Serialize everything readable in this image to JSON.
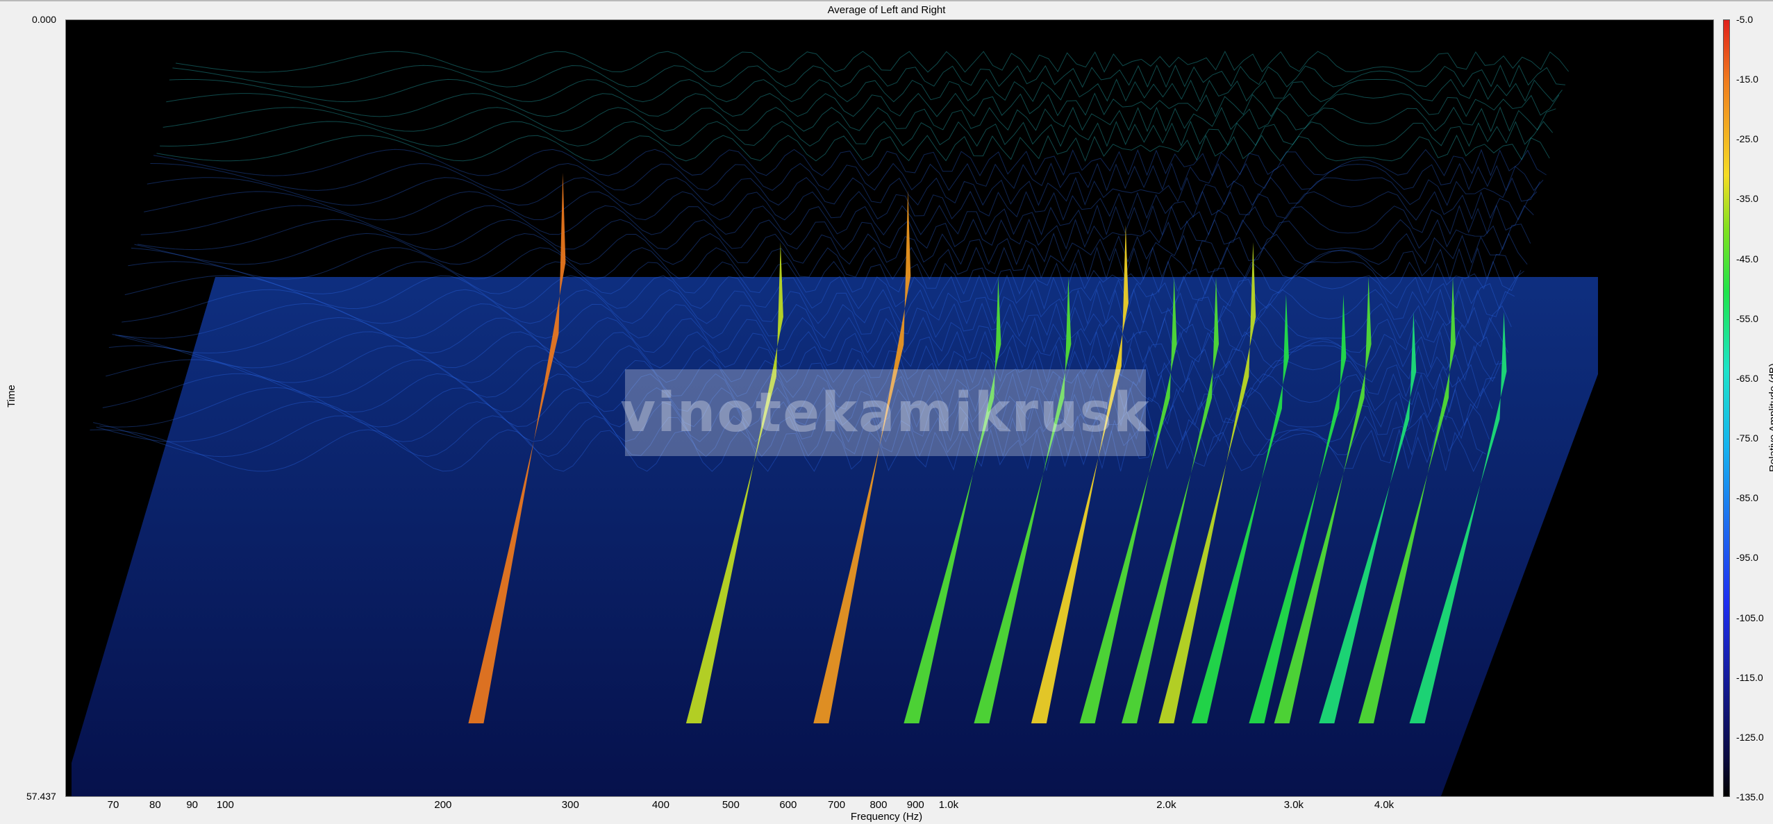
{
  "chart_data": {
    "type": "waterfall-3d",
    "title": "Average of Left and Right",
    "xlabel": "Frequency (Hz)",
    "ylabel": "Time",
    "zlabel": "Relative Amplitude (dB)",
    "x_scale": "log",
    "time_range": [
      "0.000",
      "57.437"
    ],
    "x_tick_labels": [
      {
        "label": "70",
        "value": 70
      },
      {
        "label": "80",
        "value": 80
      },
      {
        "label": "90",
        "value": 90
      },
      {
        "label": "100",
        "value": 100
      },
      {
        "label": "200",
        "value": 200
      },
      {
        "label": "300",
        "value": 300
      },
      {
        "label": "400",
        "value": 400
      },
      {
        "label": "500",
        "value": 500
      },
      {
        "label": "600",
        "value": 600
      },
      {
        "label": "700",
        "value": 700
      },
      {
        "label": "800",
        "value": 800
      },
      {
        "label": "900",
        "value": 900
      },
      {
        "label": "1.0k",
        "value": 1000
      },
      {
        "label": "2.0k",
        "value": 2000
      },
      {
        "label": "3.0k",
        "value": 3000
      },
      {
        "label": "4.0k",
        "value": 4000
      }
    ],
    "colorbar_ticks": [
      "-5.0",
      "-15.0",
      "-25.0",
      "-35.0",
      "-45.0",
      "-55.0",
      "-65.0",
      "-75.0",
      "-85.0",
      "-95.0",
      "-105.0",
      "-115.0",
      "-125.0",
      "-135.0"
    ],
    "colorbar_range_db": [
      -135,
      -5
    ],
    "peaks": [
      {
        "freq_hz": 240,
        "peak_db": -15
      },
      {
        "freq_hz": 480,
        "peak_db": -35
      },
      {
        "freq_hz": 720,
        "peak_db": -20
      },
      {
        "freq_hz": 960,
        "peak_db": -45
      },
      {
        "freq_hz": 1200,
        "peak_db": -45
      },
      {
        "freq_hz": 1440,
        "peak_db": -30
      },
      {
        "freq_hz": 1680,
        "peak_db": -45
      },
      {
        "freq_hz": 1920,
        "peak_db": -45
      },
      {
        "freq_hz": 2160,
        "peak_db": -35
      },
      {
        "freq_hz": 2400,
        "peak_db": -50
      },
      {
        "freq_hz": 2880,
        "peak_db": -50
      },
      {
        "freq_hz": 3120,
        "peak_db": -45
      },
      {
        "freq_hz": 3600,
        "peak_db": -55
      },
      {
        "freq_hz": 4080,
        "peak_db": -45
      },
      {
        "freq_hz": 4800,
        "peak_db": -55
      }
    ],
    "colors": {
      "background": "#000000",
      "hot": "#e0201c",
      "mid": "#1fe34a",
      "cool": "#1d2ef0"
    }
  },
  "watermark": "vinotekamikrusk"
}
